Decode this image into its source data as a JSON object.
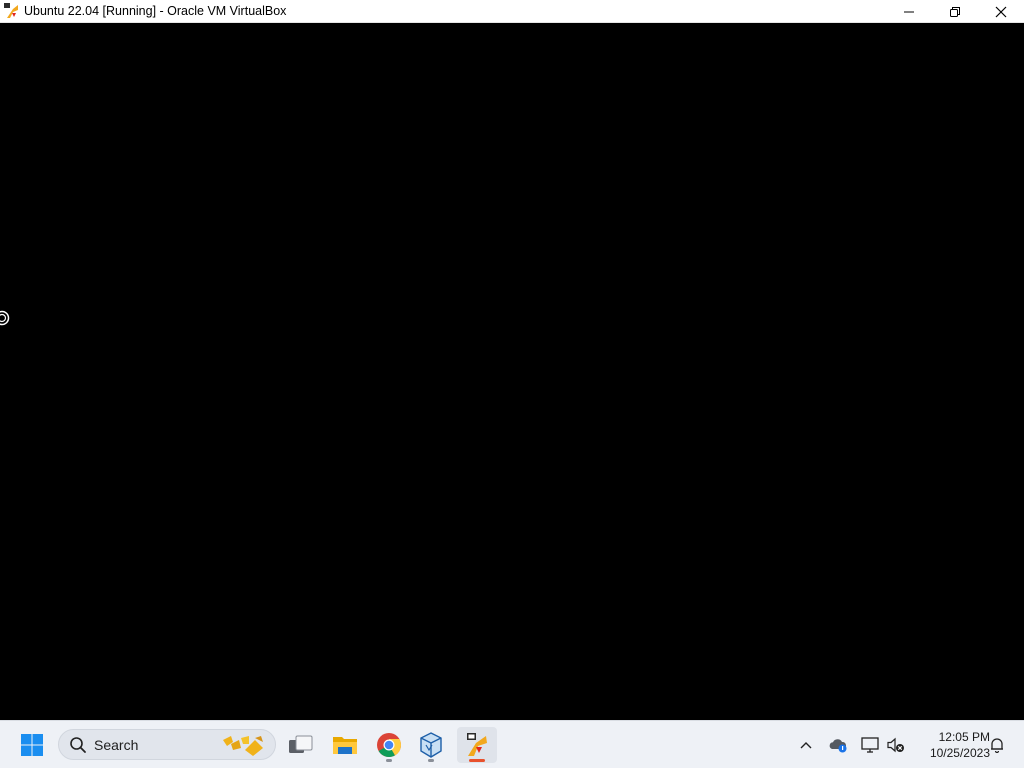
{
  "window": {
    "title": "Ubuntu 22.04 [Running] - Oracle VM VirtualBox",
    "app_icon": "virtualbox-vm-icon",
    "controls": [
      "minimize-icon",
      "restore-icon",
      "close-icon"
    ]
  },
  "vm_screen": {
    "background": "#000000",
    "indicator": "loading-spinner-icon"
  },
  "taskbar": {
    "start_icon": "windows-start-icon",
    "search": {
      "label": "Search",
      "decoration": "search-highlight-icon"
    },
    "apps": [
      {
        "name": "task-view",
        "icon": "task-view-icon",
        "running": false
      },
      {
        "name": "file-explorer",
        "icon": "folder-icon",
        "running": false
      },
      {
        "name": "chrome",
        "icon": "chrome-icon",
        "running": true
      },
      {
        "name": "virtualbox-manager",
        "icon": "virtualbox-icon",
        "running": true
      },
      {
        "name": "virtualbox-vm",
        "icon": "virtualbox-vm-icon",
        "running": true,
        "active": true
      }
    ],
    "tray": {
      "icons": [
        "chevron-up-icon",
        "onedrive-icon",
        "network-icon",
        "volume-muted-icon"
      ],
      "time": "12:05 PM",
      "date": "10/25/2023",
      "notification_icon": "bell-icon"
    },
    "colors": {
      "accent": "#0078d4",
      "active_indicator": "#e8512d"
    }
  }
}
